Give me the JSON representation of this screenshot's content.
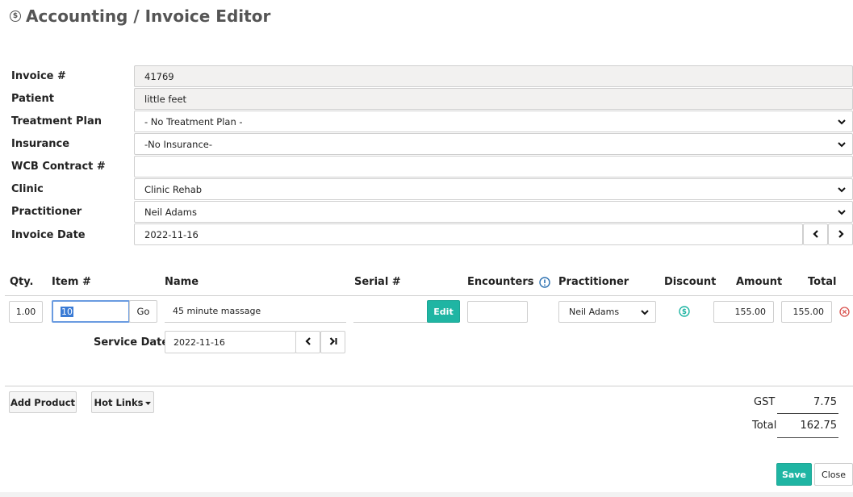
{
  "page": {
    "title": "Accounting / Invoice Editor",
    "title_icon": "dollar-circle-icon"
  },
  "form": {
    "invoice_number": {
      "label": "Invoice #",
      "value": "41769"
    },
    "patient": {
      "label": "Patient",
      "value": "little feet"
    },
    "treatment_plan": {
      "label": "Treatment Plan",
      "value": "- No Treatment Plan -"
    },
    "insurance": {
      "label": "Insurance",
      "value": "-No Insurance-"
    },
    "wcb_contract": {
      "label": "WCB Contract #",
      "value": ""
    },
    "clinic": {
      "label": "Clinic",
      "value": "Clinic Rehab"
    },
    "practitioner": {
      "label": "Practitioner",
      "value": "Neil Adams"
    },
    "invoice_date": {
      "label": "Invoice Date",
      "value": "2022-11-16"
    }
  },
  "items_table": {
    "headers": {
      "qty": "Qty.",
      "item": "Item #",
      "name": "Name",
      "serial": "Serial #",
      "encounters": "Encounters",
      "practitioner": "Practitioner",
      "discount": "Discount",
      "amount": "Amount",
      "total": "Total"
    },
    "row": {
      "qty": "1.00",
      "item": "10",
      "go_label": "Go",
      "name": "45 minute massage",
      "serial": "",
      "edit_label": "Edit",
      "encounters": "",
      "practitioner": "Neil Adams",
      "amount": "155.00",
      "total": "155.00",
      "service_date_label": "Service Date",
      "service_date": "2022-11-16"
    }
  },
  "actions": {
    "add_product": "Add Product",
    "hot_links": "Hot Links",
    "save": "Save",
    "close": "Close"
  },
  "totals": {
    "gst_label": "GST",
    "gst_value": "7.75",
    "total_label": "Total",
    "total_value": "162.75"
  },
  "colors": {
    "accent": "#1fb5a3",
    "remove_icon": "#d9534f",
    "info_icon": "#2a6fb0",
    "discount_icon": "#1fb5a3"
  }
}
